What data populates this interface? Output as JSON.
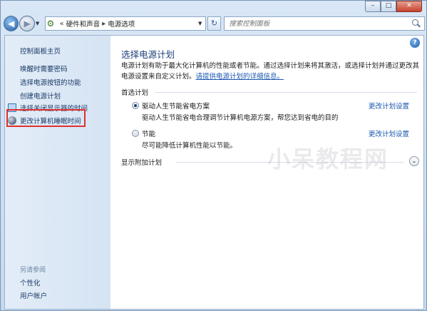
{
  "window": {
    "caption": {
      "minimize": "–",
      "maximize": "□",
      "close": "✕"
    }
  },
  "navbar": {
    "back_glyph": "◀",
    "forward_glyph": "▶",
    "history_glyph": "▼",
    "breadcrumb": [
      "硬件和声音",
      "电源选项"
    ],
    "breadcrumb_overflow": "«",
    "separator": "▸",
    "dropdown_glyph": "▼",
    "refresh_glyph": "↻",
    "search_placeholder": "搜索控制面板"
  },
  "sidebar": {
    "home_link": "控制面板主页",
    "links": [
      "唤醒时需要密码",
      "选择电源按钮的功能",
      "创建电源计划"
    ],
    "icon_links": [
      {
        "label": "选择关闭显示器的时间",
        "icon": "monitor-icon"
      },
      {
        "label": "更改计算机睡眠时间",
        "icon": "moon-icon"
      }
    ],
    "see_also_title": "另请参阅",
    "see_also": [
      "个性化",
      "用户帐户"
    ],
    "highlight_color": "#e03030"
  },
  "main": {
    "help_glyph": "?",
    "title": "选择电源计划",
    "description": "电源计划有助于最大化计算机的性能或者节能。通过选择计划来将其激活，或选择计划并通过更改其电源设置来自定义计划。",
    "description_link": "请提供电源计划的详细信息。",
    "preferred_label": "首选计划",
    "plans": [
      {
        "name": "驱动人生节能省电方案",
        "desc": "驱动人生节能省电合理调节计算机电源方案，帮您达到省电的目的",
        "link": "更改计划设置",
        "selected": true
      },
      {
        "name": "节能",
        "desc": "尽可能降低计算机性能以节能。",
        "link": "更改计划设置",
        "selected": false
      }
    ],
    "more_plans_label": "显示附加计划",
    "expand_glyph": "⌄"
  },
  "watermark": "小呆教程网",
  "colors": {
    "link": "#1a56b0",
    "title": "#1e3f7a",
    "sidebar_link": "#1a3a66"
  }
}
